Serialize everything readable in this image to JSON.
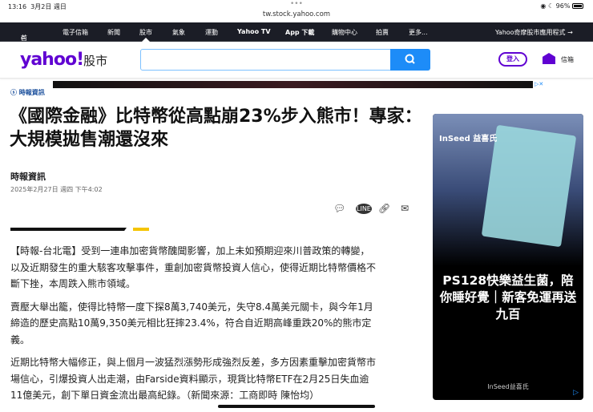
{
  "status": {
    "time": "13:16",
    "date": "3月2日 週日",
    "url": "tw.stock.yahoo.com",
    "battery": "96%"
  },
  "nav": {
    "items": [
      "首頁",
      "電子信箱",
      "新聞",
      "股市",
      "氣象",
      "運動",
      "Yahoo TV",
      "App 下載",
      "購物中心",
      "拍賣",
      "更多..."
    ],
    "app_link": "Yahoo奇摩股市應用程式 →"
  },
  "header": {
    "logo": "yahoo!",
    "section": "股市",
    "search_placeholder": "",
    "login": "登入",
    "mail": "信箱"
  },
  "article": {
    "source": "時報資訊",
    "title": "《國際金融》比特幣從高點崩23%步入熊市！專家：大規模拋售潮還沒來",
    "author": "時報資訊",
    "date": "2025年2月27日 週四 下午4:02",
    "paragraphs": [
      "【時報-台北電】受到一連串加密貨幣醜聞影響，加上未如預期迎來川普政策的轉變，以及近期發生的重大駭客攻擊事件，重創加密貨幣投資人信心，使得近期比特幣價格不斷下挫，本周跌入熊市領域。",
      "賣壓大舉出籠，使得比特幣一度下探8萬3,740美元，失守8.4萬美元關卡，與今年1月締造的歷史高點10萬9,350美元相比狂摔23.4%，符合自近期高峰重跌20%的熊市定義。",
      "近期比特幣大幅修正，與上個月一波猛烈漲勢形成強烈反差，多方因素重擊加密貨幣市場信心，引爆投資人出走潮，由Farside資料顯示，現貨比特幣ETF在2月25日失血逾11億美元，創下單日資金流出最高紀錄。（新聞來源：工商即時 陳怡均）"
    ]
  },
  "ad": {
    "brand": "InSeed 益喜氏",
    "headline": "PS128快樂益生菌，陪你睡好覺｜新客免運再送九百",
    "sponsor": "InSeed益喜氏"
  },
  "colors": {
    "brand": "#6001d2",
    "search": "#1d8cf8",
    "nav": "#1b1d26"
  }
}
